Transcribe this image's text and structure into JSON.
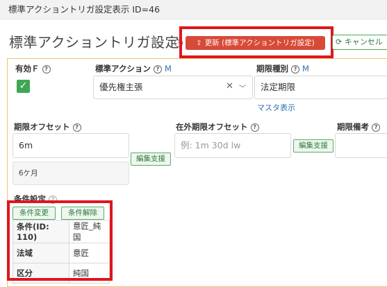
{
  "topbar": {
    "title": "標準アクショントリガ設定表示 ID=46"
  },
  "header": {
    "title": "標準アクショントリガ設定",
    "update_label": "更新 (標準アクショントリガ設定)",
    "cancel_label": "キャンセル"
  },
  "form": {
    "enabled_label": "有効Ｆ",
    "action_label": "標準アクション",
    "action_m": "M",
    "action_value": "優先権主張",
    "period_type_label": "期限種別",
    "period_type_m": "M",
    "period_type_value": "法定期限",
    "master_link": "マスタ表示",
    "offset_label": "期限オフセット",
    "offset_value": "6m",
    "offset_readable": "6ケ月",
    "edit_help_1": "編集支援",
    "foreign_offset_label": "在外期限オフセット",
    "foreign_offset_placeholder": "例: 1m 30d lw",
    "edit_help_2": "編集支援",
    "remarks_label": "期限備考"
  },
  "condition": {
    "label": "条件設定",
    "change_label": "条件変更",
    "clear_label": "条件解除",
    "rows": [
      {
        "key": "条件(ID: 110)",
        "value": "意匠_純国"
      },
      {
        "key": "法域",
        "value": "意匠"
      },
      {
        "key": "区分",
        "value": "純国"
      }
    ]
  },
  "colors": {
    "accent_red": "#d84a38",
    "highlight": "#e0161b",
    "check_green": "#3fa753"
  }
}
